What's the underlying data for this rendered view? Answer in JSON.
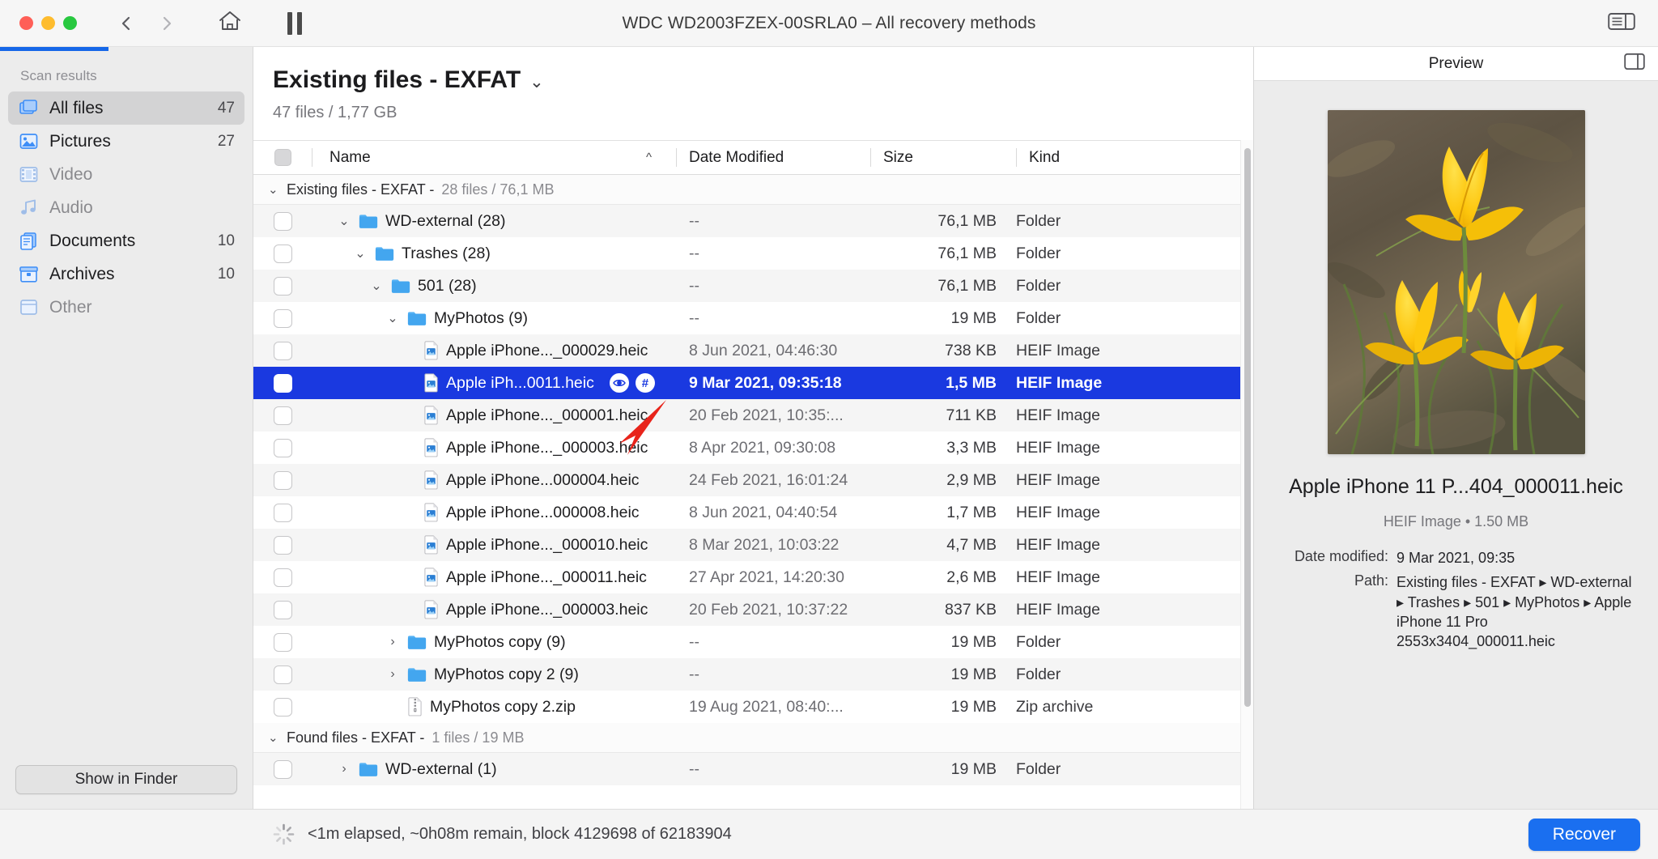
{
  "window": {
    "title": "WDC WD2003FZEX-00SRLA0 – All recovery methods",
    "back_icon": "chevron-left-icon",
    "forward_icon": "chevron-right-icon",
    "home_icon": "home-icon",
    "pause_icon": "pause-icon",
    "sidebar_toggle_icon": "sidebar-toggle-icon"
  },
  "sidebar": {
    "section_label": "Scan results",
    "progress_percent": 43,
    "items": [
      {
        "label": "All files",
        "count": "47",
        "icon": "all-files-icon",
        "active": true,
        "dim": false
      },
      {
        "label": "Pictures",
        "count": "27",
        "icon": "pictures-icon",
        "active": false,
        "dim": false
      },
      {
        "label": "Video",
        "count": "",
        "icon": "video-icon",
        "active": false,
        "dim": true
      },
      {
        "label": "Audio",
        "count": "",
        "icon": "audio-icon",
        "active": false,
        "dim": true
      },
      {
        "label": "Documents",
        "count": "10",
        "icon": "documents-icon",
        "active": false,
        "dim": false
      },
      {
        "label": "Archives",
        "count": "10",
        "icon": "archives-icon",
        "active": false,
        "dim": false
      },
      {
        "label": "Other",
        "count": "",
        "icon": "other-icon",
        "active": false,
        "dim": true
      }
    ],
    "show_in_finder_label": "Show in Finder"
  },
  "content": {
    "title": "Existing files - EXFAT",
    "title_caret_icon": "chevron-down-icon",
    "subtitle": "47 files / 1,77 GB"
  },
  "table": {
    "columns": {
      "check": "",
      "name": "Name",
      "date": "Date Modified",
      "size": "Size",
      "kind": "Kind"
    },
    "sort_indicator": "^",
    "rows": [
      {
        "type": "group",
        "label": "Existing files - EXFAT - ",
        "meta": "28 files / 76,1 MB",
        "twisty": "open"
      },
      {
        "type": "folder",
        "indent": 0,
        "twisty": "open",
        "name": "WD-external (28)",
        "date": "--",
        "size": "76,1 MB",
        "kind": "Folder",
        "shade": "odd"
      },
      {
        "type": "folder",
        "indent": 1,
        "twisty": "open",
        "name": "Trashes (28)",
        "date": "--",
        "size": "76,1 MB",
        "kind": "Folder",
        "shade": "even"
      },
      {
        "type": "folder",
        "indent": 2,
        "twisty": "open",
        "name": "501 (28)",
        "date": "--",
        "size": "76,1 MB",
        "kind": "Folder",
        "shade": "odd"
      },
      {
        "type": "folder",
        "indent": 3,
        "twisty": "open",
        "name": "MyPhotos (9)",
        "date": "--",
        "size": "19 MB",
        "kind": "Folder",
        "shade": "even"
      },
      {
        "type": "file",
        "indent": 4,
        "name": "Apple iPhone..._000029.heic",
        "date": "8 Jun 2021, 04:46:30",
        "size": "738 KB",
        "kind": "HEIF Image",
        "shade": "odd"
      },
      {
        "type": "file",
        "indent": 4,
        "name": "Apple iPh...0011.heic",
        "date": "9 Mar 2021, 09:35:18",
        "size": "1,5 MB",
        "kind": "HEIF Image",
        "shade": "selected",
        "selected": true,
        "actions": [
          "eye-icon",
          "hash-icon"
        ]
      },
      {
        "type": "file",
        "indent": 4,
        "name": "Apple iPhone..._000001.heic",
        "date": "20 Feb 2021, 10:35:...",
        "size": "711 KB",
        "kind": "HEIF Image",
        "shade": "odd"
      },
      {
        "type": "file",
        "indent": 4,
        "name": "Apple iPhone..._000003.heic",
        "date": "8 Apr 2021, 09:30:08",
        "size": "3,3 MB",
        "kind": "HEIF Image",
        "shade": "even"
      },
      {
        "type": "file",
        "indent": 4,
        "name": "Apple iPhone...000004.heic",
        "date": "24 Feb 2021, 16:01:24",
        "size": "2,9 MB",
        "kind": "HEIF Image",
        "shade": "odd"
      },
      {
        "type": "file",
        "indent": 4,
        "name": "Apple iPhone...000008.heic",
        "date": "8 Jun 2021, 04:40:54",
        "size": "1,7 MB",
        "kind": "HEIF Image",
        "shade": "even"
      },
      {
        "type": "file",
        "indent": 4,
        "name": "Apple iPhone..._000010.heic",
        "date": "8 Mar 2021, 10:03:22",
        "size": "4,7 MB",
        "kind": "HEIF Image",
        "shade": "odd"
      },
      {
        "type": "file",
        "indent": 4,
        "name": "Apple iPhone..._000011.heic",
        "date": "27 Apr 2021, 14:20:30",
        "size": "2,6 MB",
        "kind": "HEIF Image",
        "shade": "even"
      },
      {
        "type": "file",
        "indent": 4,
        "name": "Apple iPhone..._000003.heic",
        "date": "20 Feb 2021, 10:37:22",
        "size": "837 KB",
        "kind": "HEIF Image",
        "shade": "odd"
      },
      {
        "type": "folder",
        "indent": 3,
        "twisty": "closed",
        "name": "MyPhotos copy (9)",
        "date": "--",
        "size": "19 MB",
        "kind": "Folder",
        "shade": "even"
      },
      {
        "type": "folder",
        "indent": 3,
        "twisty": "closed",
        "name": "MyPhotos copy 2 (9)",
        "date": "--",
        "size": "19 MB",
        "kind": "Folder",
        "shade": "odd"
      },
      {
        "type": "file",
        "indent": 3,
        "name": "MyPhotos copy 2.zip",
        "date": "19 Aug 2021, 08:40:...",
        "size": "19 MB",
        "kind": "Zip archive",
        "shade": "even",
        "icon": "zip-icon"
      },
      {
        "type": "group",
        "label": "Found files - EXFAT - ",
        "meta": "1 files / 19 MB",
        "twisty": "open"
      },
      {
        "type": "folder",
        "indent": 0,
        "twisty": "closed",
        "name": "WD-external (1)",
        "date": "--",
        "size": "19 MB",
        "kind": "Folder",
        "shade": "odd"
      }
    ]
  },
  "preview": {
    "header": "Preview",
    "expand_icon": "expand-panel-icon",
    "filename": "Apple iPhone 11 P...404_000011.heic",
    "kind_line": "HEIF Image • 1.50 MB",
    "fields": [
      {
        "key": "Date modified:",
        "value": "9 Mar 2021, 09:35"
      },
      {
        "key": "Path:",
        "value": "Existing files - EXFAT ▸ WD-external ▸ Trashes ▸ 501 ▸ MyPhotos ▸ Apple iPhone 11 Pro 2553x3404_000011.heic"
      }
    ]
  },
  "statusbar": {
    "spinner_icon": "loading-spinner-icon",
    "text": "<1m elapsed, ~0h08m remain, block 4129698 of 62183904",
    "recover_label": "Recover"
  },
  "colors": {
    "accent_blue": "#1a6ff0",
    "selection_blue": "#1a39e0",
    "sidebar_bg": "#ececec",
    "annotation_red": "#e8241b"
  }
}
